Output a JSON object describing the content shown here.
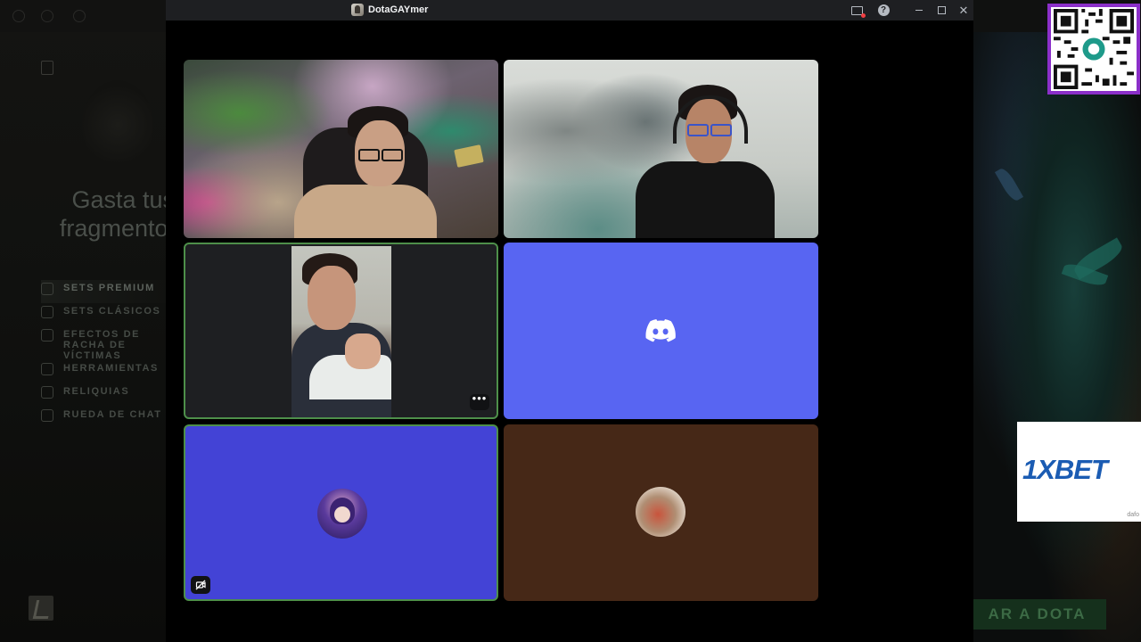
{
  "window": {
    "title": "DotaGAYmer"
  },
  "background_client": {
    "promo_line1": "Gasta tus",
    "promo_line2": "fragmento.",
    "menu": [
      {
        "label": "SETS PREMIUM",
        "active": true
      },
      {
        "label": "SETS CLÁSICOS",
        "active": false
      },
      {
        "label": "EFECTOS DE RACHA DE VÍCTIMAS",
        "active": false
      },
      {
        "label": "HERRAMIENTAS",
        "active": false
      },
      {
        "label": "RELIQUIAS",
        "active": false
      },
      {
        "label": "RUEDA DE CHAT",
        "active": false
      }
    ],
    "play_button": "AR A DOTA"
  },
  "call": {
    "tiles": [
      {
        "kind": "video",
        "speaking": false
      },
      {
        "kind": "video",
        "speaking": false
      },
      {
        "kind": "video",
        "speaking": true
      },
      {
        "kind": "placeholder-logo",
        "speaking": false,
        "color": "#5865f2"
      },
      {
        "kind": "avatar",
        "speaking": true,
        "muted": true,
        "color": "#4343d6"
      },
      {
        "kind": "avatar",
        "speaking": false,
        "color": "#462817"
      }
    ],
    "more_label": "•••"
  },
  "overlays": {
    "ad_brand": "1XBET",
    "ad_small": "dafo",
    "qr_border_color": "#8b2fc9"
  }
}
